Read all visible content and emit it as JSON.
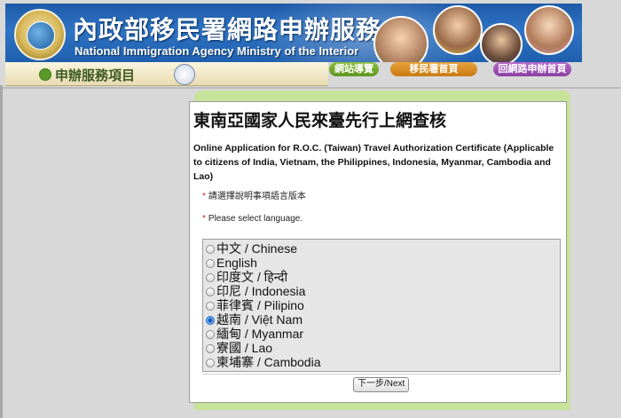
{
  "header": {
    "title_zh": "內政部移民署網路申辦服務",
    "title_en": "National Immigration Agency Ministry of the Interior",
    "nav": [
      {
        "label": "網站導覽"
      },
      {
        "label": "移民署首頁"
      },
      {
        "label": "回網路申辦首頁"
      }
    ],
    "section_label": "申辦服務項目"
  },
  "form": {
    "title": "東南亞國家人民來臺先行上網查核",
    "subtitle": "Online Application for R.O.C. (Taiwan) Travel Authorization Certificate (Applicable to citizens of India, Vietnam, the Philippines, Indonesia, Myanmar, Cambodia and Lao)",
    "required_mark": "*",
    "note_zh": "請選擇說明事項語言版本",
    "note_en": "Please select language.",
    "languages": [
      {
        "label": "中文 / Chinese",
        "checked": false
      },
      {
        "label": "English",
        "checked": false
      },
      {
        "label": "印度文 / हिन्दी",
        "checked": false
      },
      {
        "label": "印尼 / Indonesia",
        "checked": false
      },
      {
        "label": "菲律賓 / Pilipino",
        "checked": false
      },
      {
        "label": "越南 / Việt Nam",
        "checked": true
      },
      {
        "label": "緬甸 / Myanmar",
        "checked": false
      },
      {
        "label": "寮國 / Lao",
        "checked": false
      },
      {
        "label": "柬埔寨 / Cambodia",
        "checked": false
      }
    ],
    "next_button": "下一步/Next"
  }
}
